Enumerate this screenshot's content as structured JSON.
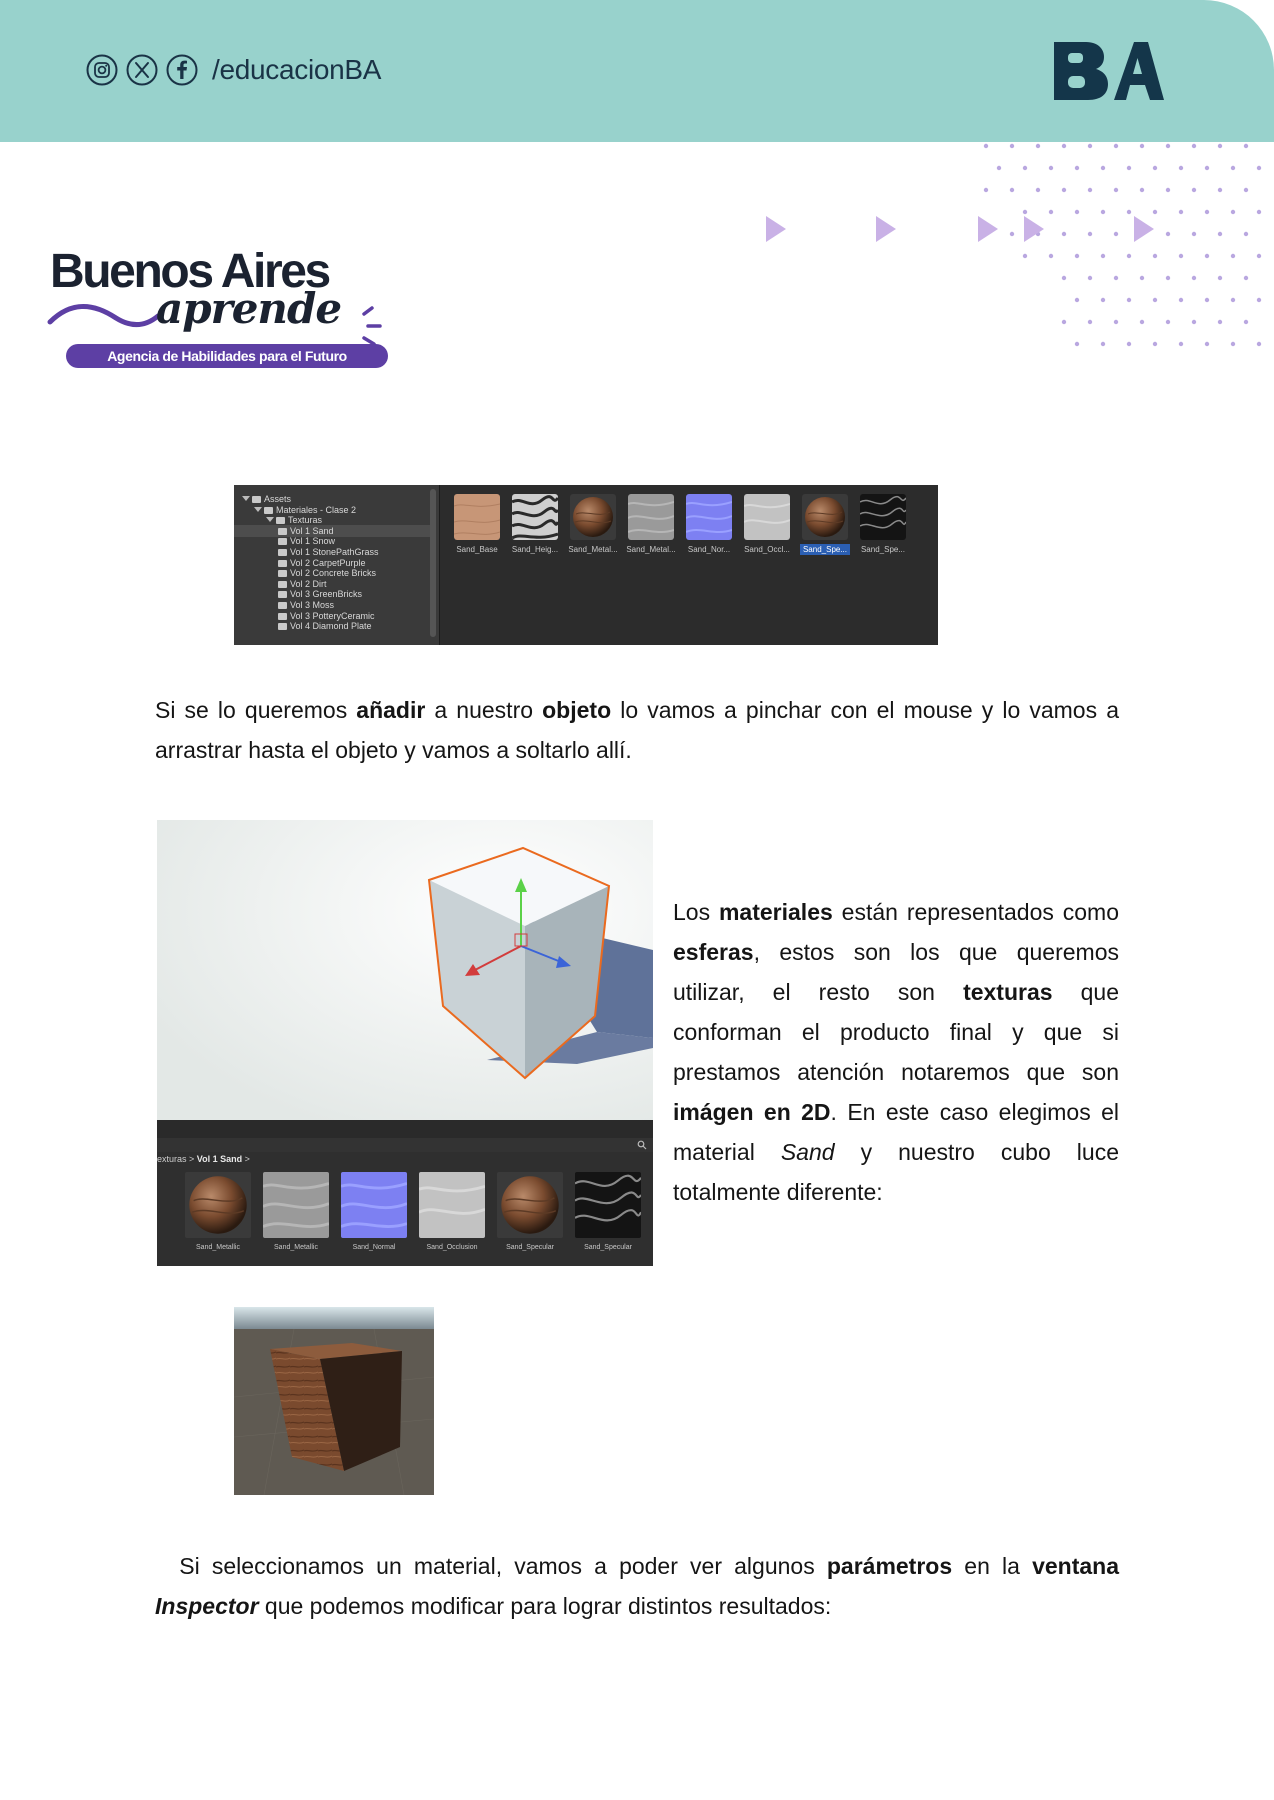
{
  "header": {
    "social_handle": "/educacionBA",
    "social_icons": [
      "instagram-icon",
      "x-icon",
      "facebook-icon"
    ],
    "logo_text": "BA",
    "background_color": "#98d2cc",
    "logo_color": "#14364a"
  },
  "brand": {
    "title": "Buenos Aires",
    "script": "aprende",
    "tagline": "Agencia de Habilidades para el Futuro",
    "accent_color": "#5d3fa4"
  },
  "decorations": {
    "dot_color": "#b9a7e0",
    "arrow_color": "#c9b1e6"
  },
  "project_browser": {
    "tree": [
      {
        "label": "Assets",
        "depth": 0,
        "type": "folder-open"
      },
      {
        "label": "Materiales - Clase 2",
        "depth": 1,
        "type": "folder-open"
      },
      {
        "label": "Texturas",
        "depth": 2,
        "type": "folder-open"
      },
      {
        "label": "Vol 1 Sand",
        "depth": 3,
        "type": "folder",
        "selected": true
      },
      {
        "label": "Vol 1 Snow",
        "depth": 3,
        "type": "folder"
      },
      {
        "label": "Vol 1 StonePathGrass",
        "depth": 3,
        "type": "folder"
      },
      {
        "label": "Vol 2 CarpetPurple",
        "depth": 3,
        "type": "folder"
      },
      {
        "label": "Vol 2 Concrete Bricks",
        "depth": 3,
        "type": "folder"
      },
      {
        "label": "Vol 2 Dirt",
        "depth": 3,
        "type": "folder"
      },
      {
        "label": "Vol 3 GreenBricks",
        "depth": 3,
        "type": "folder"
      },
      {
        "label": "Vol 3 Moss",
        "depth": 3,
        "type": "folder"
      },
      {
        "label": "Vol 3 PotteryCeramic",
        "depth": 3,
        "type": "folder"
      },
      {
        "label": "Vol 4 Diamond Plate",
        "depth": 3,
        "type": "folder"
      }
    ],
    "assets": [
      {
        "label": "Sand_Base",
        "kind": "base"
      },
      {
        "label": "Sand_Heig...",
        "kind": "height"
      },
      {
        "label": "Sand_Metal...",
        "kind": "sphere"
      },
      {
        "label": "Sand_Metal...",
        "kind": "gray"
      },
      {
        "label": "Sand_Nor...",
        "kind": "normal"
      },
      {
        "label": "Sand_Occl...",
        "kind": "lightgray"
      },
      {
        "label": "Sand_Spe...",
        "kind": "sphere",
        "selected": true
      },
      {
        "label": "Sand_Spe...",
        "kind": "dark"
      }
    ]
  },
  "scene_view": {
    "breadcrumb_prefix": "exturas",
    "breadcrumb_current": "Vol 1 Sand",
    "assets": [
      {
        "label": "Sand_Metallic",
        "kind": "sphere"
      },
      {
        "label": "Sand_Metallic",
        "kind": "gray"
      },
      {
        "label": "Sand_Normal",
        "kind": "normal"
      },
      {
        "label": "Sand_Occlusion",
        "kind": "lightgray"
      },
      {
        "label": "Sand_Specular",
        "kind": "sphere"
      },
      {
        "label": "Sand_Specular",
        "kind": "dark"
      }
    ]
  },
  "text": {
    "p1_a": "Si se lo queremos ",
    "p1_b": "añadir",
    "p1_c": " a nuestro ",
    "p1_d": "objeto",
    "p1_e": " lo vamos a pinchar con el mouse y lo vamos a arrastrar hasta el objeto y vamos a soltarlo allí.",
    "p2_a": "Los ",
    "p2_b": "materiales",
    "p2_c": " están representados como ",
    "p2_d": "esferas",
    "p2_e": ", estos son los que queremos utilizar, el resto son ",
    "p2_f": "texturas",
    "p2_g": " que conforman el producto final y que si prestamos atención notaremos que son ",
    "p2_h": "imágen en 2D",
    "p2_i": ". En este caso elegimos el material ",
    "p2_j": "Sand",
    "p2_k": " y nuestro cubo luce totalmente diferente:",
    "p3_a": "  Si seleccionamos un material, vamos a poder ver algunos ",
    "p3_b": "parámetros",
    "p3_c": " en la ",
    "p3_d": "ventana",
    "p3_e": "Inspector",
    "p3_f": " que podemos modificar para lograr distintos resultados:"
  }
}
